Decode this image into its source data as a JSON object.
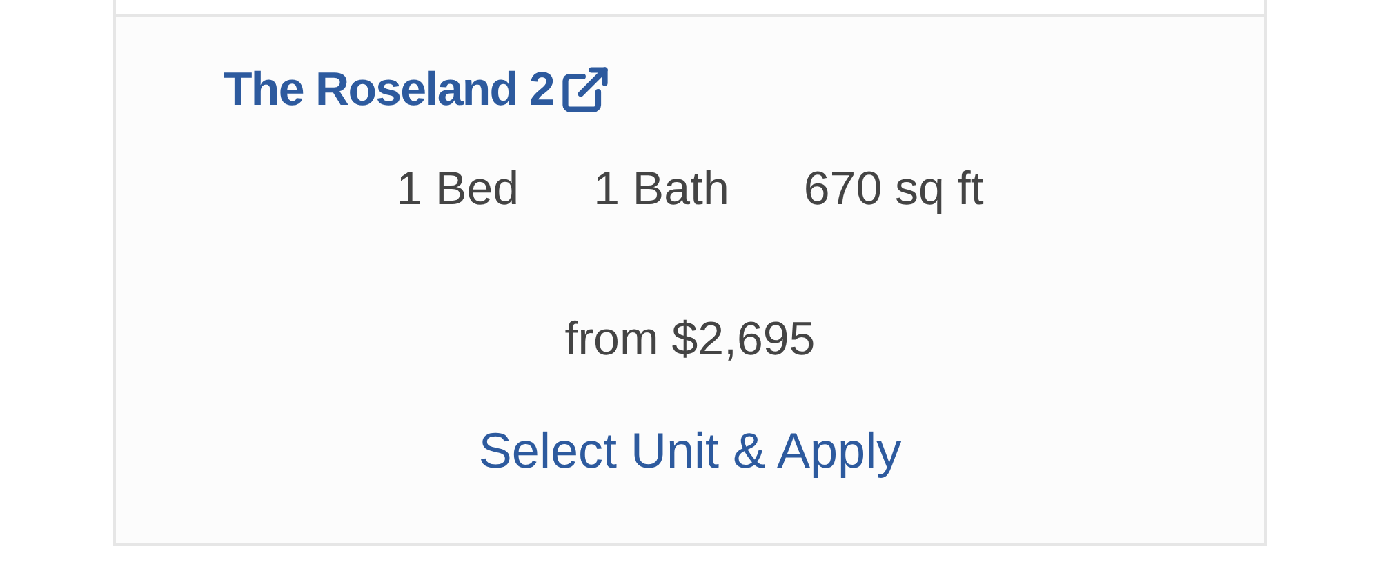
{
  "listing": {
    "title": "The Roseland 2",
    "specs": [
      "1 Bed",
      "1 Bath",
      "670 sq ft"
    ],
    "price": "from $2,695",
    "action": "Select Unit & Apply"
  }
}
